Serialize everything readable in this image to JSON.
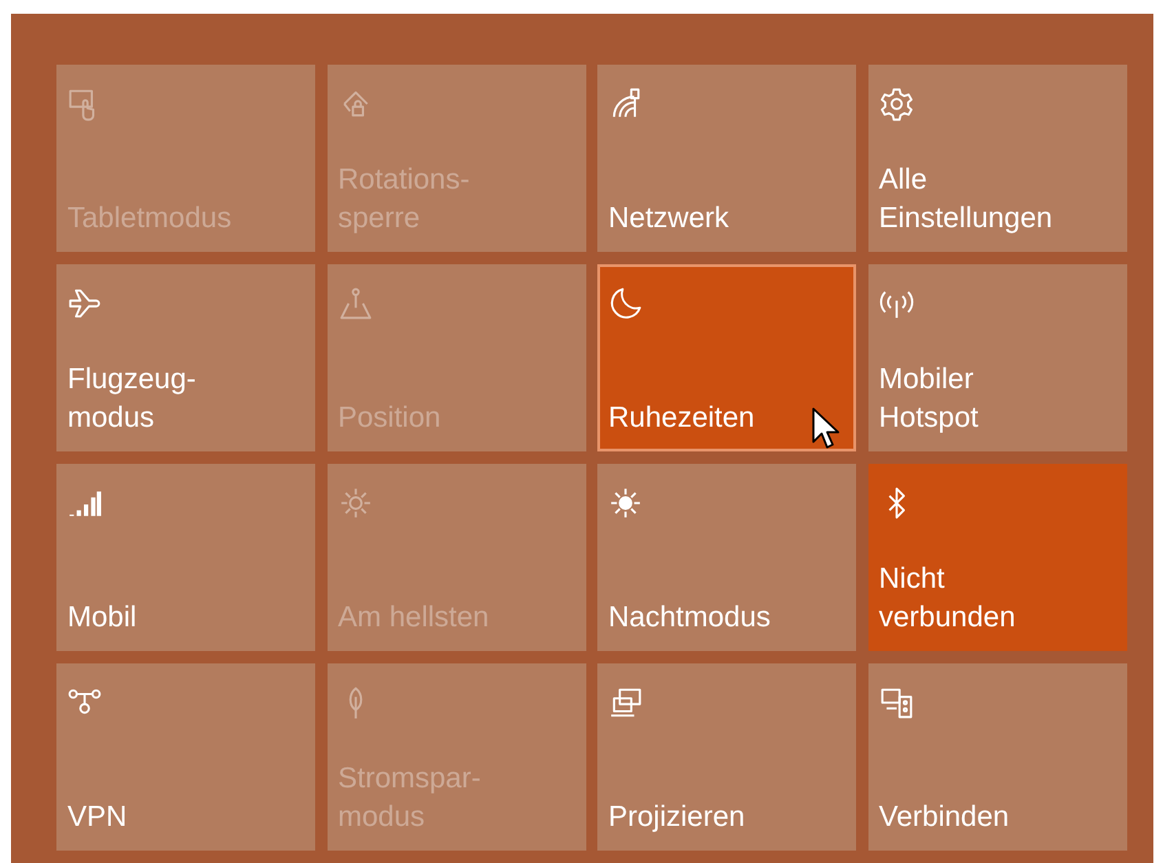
{
  "tiles": [
    {
      "lines": [
        "Tabletmodus"
      ],
      "on": false,
      "disabled": true,
      "hovered": false
    },
    {
      "lines": [
        "Rotations-",
        "sperre"
      ],
      "on": false,
      "disabled": true,
      "hovered": false
    },
    {
      "lines": [
        "Netzwerk"
      ],
      "on": false,
      "disabled": false,
      "hovered": false
    },
    {
      "lines": [
        "Alle",
        "Einstellungen"
      ],
      "on": false,
      "disabled": false,
      "hovered": false
    },
    {
      "lines": [
        "Flugzeug-",
        "modus"
      ],
      "on": false,
      "disabled": false,
      "hovered": false
    },
    {
      "lines": [
        "Position"
      ],
      "on": false,
      "disabled": true,
      "hovered": false
    },
    {
      "lines": [
        "Ruhezeiten"
      ],
      "on": true,
      "disabled": false,
      "hovered": true
    },
    {
      "lines": [
        "Mobiler",
        "Hotspot"
      ],
      "on": false,
      "disabled": false,
      "hovered": false
    },
    {
      "lines": [
        "Mobil"
      ],
      "on": false,
      "disabled": false,
      "hovered": false
    },
    {
      "lines": [
        "Am hellsten"
      ],
      "on": false,
      "disabled": true,
      "hovered": false
    },
    {
      "lines": [
        "Nachtmodus"
      ],
      "on": false,
      "disabled": false,
      "hovered": false
    },
    {
      "lines": [
        "Nicht",
        "verbunden"
      ],
      "on": true,
      "disabled": false,
      "hovered": false
    },
    {
      "lines": [
        "VPN"
      ],
      "on": false,
      "disabled": false,
      "hovered": false
    },
    {
      "lines": [
        "Stromspar-",
        "modus"
      ],
      "on": false,
      "disabled": true,
      "hovered": false
    },
    {
      "lines": [
        "Projizieren"
      ],
      "on": false,
      "disabled": false,
      "hovered": false
    },
    {
      "lines": [
        "Verbinden"
      ],
      "on": false,
      "disabled": false,
      "hovered": false
    }
  ]
}
